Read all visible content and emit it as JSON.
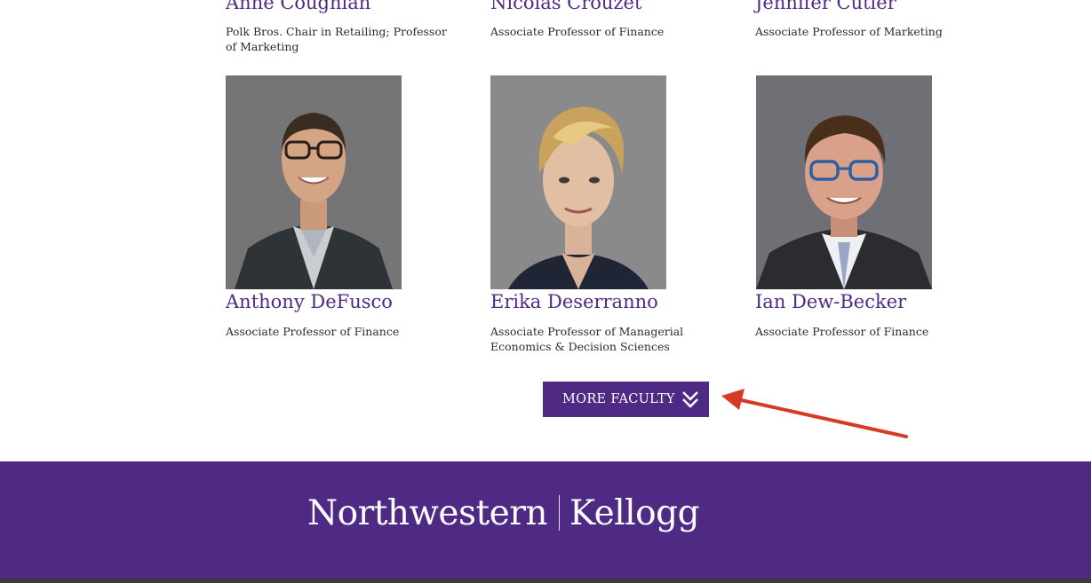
{
  "faculty": {
    "top_row": [
      {
        "name": "Anne Coughlan",
        "title": "Polk Bros. Chair in Retailing; Professor of Marketing"
      },
      {
        "name": "Nicolas Crouzet",
        "title": "Associate Professor of Finance"
      },
      {
        "name": "Jennifer Cutler",
        "title": "Associate Professor of Marketing"
      }
    ],
    "second_row": [
      {
        "name": "Anthony DeFusco",
        "title": "Associate Professor of Finance"
      },
      {
        "name": "Erika Deserranno",
        "title": "Associate Professor of Managerial Economics & Decision Sciences"
      },
      {
        "name": "Ian Dew-Becker",
        "title": "Associate Professor of Finance"
      }
    ]
  },
  "more_button": {
    "label": "MORE FACULTY",
    "icon": "double-chevron-down-icon"
  },
  "annotation": {
    "icon": "red-arrow-icon",
    "color": "#d63a24"
  },
  "footer": {
    "logo_left": "Northwestern",
    "logo_right": "Kellogg",
    "background": "#4e2a84"
  },
  "colors": {
    "accent": "#4e2a84",
    "text": "#2b2b2b"
  }
}
